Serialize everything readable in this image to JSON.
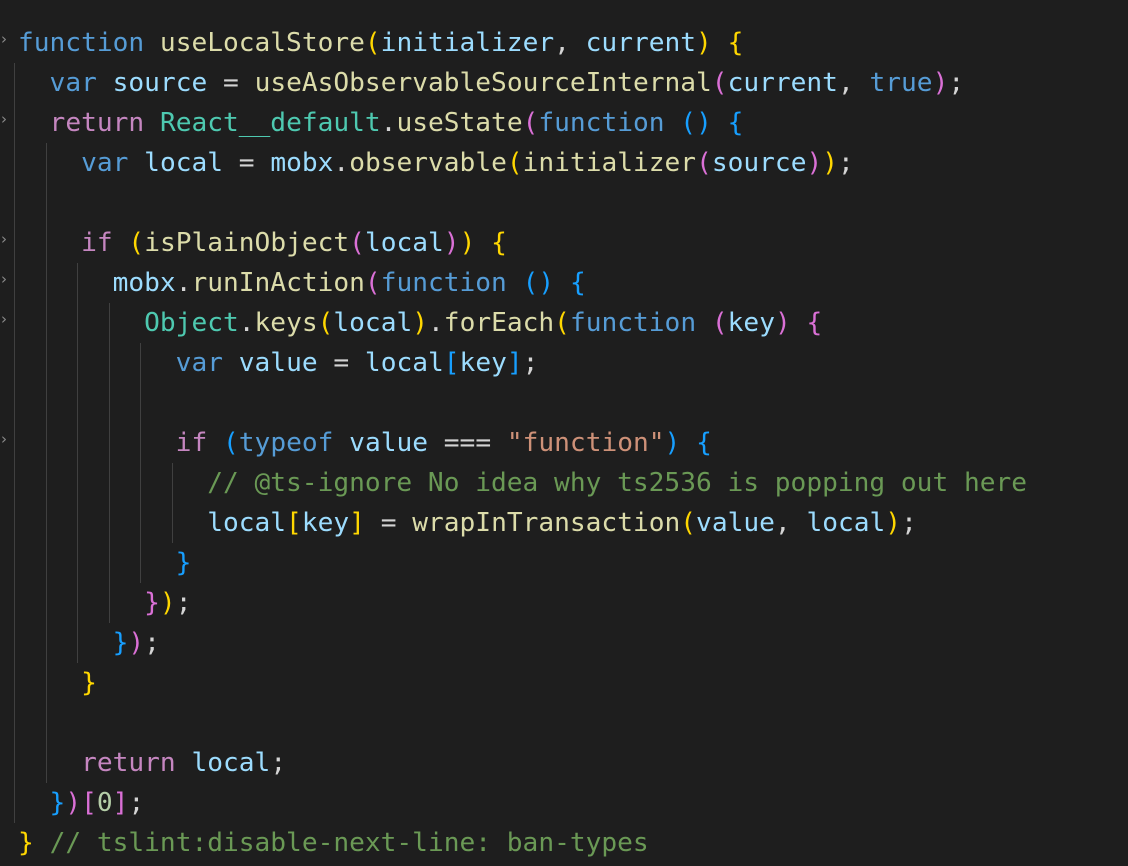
{
  "editor": {
    "theme": {
      "background": "#1e1e1e",
      "text": "#d4d4d4"
    },
    "fold_marker": "›",
    "lines": [
      [
        {
          "text": "function",
          "cls": "kw"
        },
        {
          "text": " ",
          "cls": "p"
        },
        {
          "text": "useLocalStore",
          "cls": "fn"
        },
        {
          "text": "(",
          "cls": "b1"
        },
        {
          "text": "initializer",
          "cls": "var"
        },
        {
          "text": ", ",
          "cls": "p"
        },
        {
          "text": "current",
          "cls": "var"
        },
        {
          "text": ")",
          "cls": "b1"
        },
        {
          "text": " ",
          "cls": "p"
        },
        {
          "text": "{",
          "cls": "b1"
        }
      ],
      [
        {
          "text": "  ",
          "cls": "p"
        },
        {
          "text": "var",
          "cls": "kw"
        },
        {
          "text": " ",
          "cls": "p"
        },
        {
          "text": "source",
          "cls": "var"
        },
        {
          "text": " = ",
          "cls": "p"
        },
        {
          "text": "useAsObservableSourceInternal",
          "cls": "fn"
        },
        {
          "text": "(",
          "cls": "b2"
        },
        {
          "text": "current",
          "cls": "var"
        },
        {
          "text": ", ",
          "cls": "p"
        },
        {
          "text": "true",
          "cls": "kw"
        },
        {
          "text": ")",
          "cls": "b2"
        },
        {
          "text": ";",
          "cls": "p"
        }
      ],
      [
        {
          "text": "  ",
          "cls": "p"
        },
        {
          "text": "return",
          "cls": "ctl"
        },
        {
          "text": " ",
          "cls": "p"
        },
        {
          "text": "React__default",
          "cls": "cls"
        },
        {
          "text": ".",
          "cls": "p"
        },
        {
          "text": "useState",
          "cls": "fn"
        },
        {
          "text": "(",
          "cls": "b2"
        },
        {
          "text": "function",
          "cls": "kw"
        },
        {
          "text": " ",
          "cls": "p"
        },
        {
          "text": "()",
          "cls": "b3"
        },
        {
          "text": " ",
          "cls": "p"
        },
        {
          "text": "{",
          "cls": "b3"
        }
      ],
      [
        {
          "text": "    ",
          "cls": "p"
        },
        {
          "text": "var",
          "cls": "kw"
        },
        {
          "text": " ",
          "cls": "p"
        },
        {
          "text": "local",
          "cls": "var"
        },
        {
          "text": " = ",
          "cls": "p"
        },
        {
          "text": "mobx",
          "cls": "var"
        },
        {
          "text": ".",
          "cls": "p"
        },
        {
          "text": "observable",
          "cls": "fn"
        },
        {
          "text": "(",
          "cls": "b1"
        },
        {
          "text": "initializer",
          "cls": "fn"
        },
        {
          "text": "(",
          "cls": "b2"
        },
        {
          "text": "source",
          "cls": "var"
        },
        {
          "text": ")",
          "cls": "b2"
        },
        {
          "text": ")",
          "cls": "b1"
        },
        {
          "text": ";",
          "cls": "p"
        }
      ],
      [],
      [
        {
          "text": "    ",
          "cls": "p"
        },
        {
          "text": "if",
          "cls": "ctl"
        },
        {
          "text": " ",
          "cls": "p"
        },
        {
          "text": "(",
          "cls": "b1"
        },
        {
          "text": "isPlainObject",
          "cls": "fn"
        },
        {
          "text": "(",
          "cls": "b2"
        },
        {
          "text": "local",
          "cls": "var"
        },
        {
          "text": ")",
          "cls": "b2"
        },
        {
          "text": ")",
          "cls": "b1"
        },
        {
          "text": " ",
          "cls": "p"
        },
        {
          "text": "{",
          "cls": "b1"
        }
      ],
      [
        {
          "text": "      ",
          "cls": "p"
        },
        {
          "text": "mobx",
          "cls": "var"
        },
        {
          "text": ".",
          "cls": "p"
        },
        {
          "text": "runInAction",
          "cls": "fn"
        },
        {
          "text": "(",
          "cls": "b2"
        },
        {
          "text": "function",
          "cls": "kw"
        },
        {
          "text": " ",
          "cls": "p"
        },
        {
          "text": "()",
          "cls": "b3"
        },
        {
          "text": " ",
          "cls": "p"
        },
        {
          "text": "{",
          "cls": "b3"
        }
      ],
      [
        {
          "text": "        ",
          "cls": "p"
        },
        {
          "text": "Object",
          "cls": "cls"
        },
        {
          "text": ".",
          "cls": "p"
        },
        {
          "text": "keys",
          "cls": "fn"
        },
        {
          "text": "(",
          "cls": "b1"
        },
        {
          "text": "local",
          "cls": "var"
        },
        {
          "text": ")",
          "cls": "b1"
        },
        {
          "text": ".",
          "cls": "p"
        },
        {
          "text": "forEach",
          "cls": "fn"
        },
        {
          "text": "(",
          "cls": "b1"
        },
        {
          "text": "function",
          "cls": "kw"
        },
        {
          "text": " ",
          "cls": "p"
        },
        {
          "text": "(",
          "cls": "b2"
        },
        {
          "text": "key",
          "cls": "var"
        },
        {
          "text": ")",
          "cls": "b2"
        },
        {
          "text": " ",
          "cls": "p"
        },
        {
          "text": "{",
          "cls": "b2"
        }
      ],
      [
        {
          "text": "          ",
          "cls": "p"
        },
        {
          "text": "var",
          "cls": "kw"
        },
        {
          "text": " ",
          "cls": "p"
        },
        {
          "text": "value",
          "cls": "var"
        },
        {
          "text": " = ",
          "cls": "p"
        },
        {
          "text": "local",
          "cls": "var"
        },
        {
          "text": "[",
          "cls": "b3"
        },
        {
          "text": "key",
          "cls": "var"
        },
        {
          "text": "]",
          "cls": "b3"
        },
        {
          "text": ";",
          "cls": "p"
        }
      ],
      [],
      [
        {
          "text": "          ",
          "cls": "p"
        },
        {
          "text": "if",
          "cls": "ctl"
        },
        {
          "text": " ",
          "cls": "p"
        },
        {
          "text": "(",
          "cls": "b3"
        },
        {
          "text": "typeof",
          "cls": "kw"
        },
        {
          "text": " ",
          "cls": "p"
        },
        {
          "text": "value",
          "cls": "var"
        },
        {
          "text": " === ",
          "cls": "p"
        },
        {
          "text": "\"function\"",
          "cls": "str"
        },
        {
          "text": ")",
          "cls": "b3"
        },
        {
          "text": " ",
          "cls": "p"
        },
        {
          "text": "{",
          "cls": "b3"
        }
      ],
      [
        {
          "text": "            ",
          "cls": "p"
        },
        {
          "text": "// @ts-ignore No idea why ts2536 is popping out here",
          "cls": "cmt"
        }
      ],
      [
        {
          "text": "            ",
          "cls": "p"
        },
        {
          "text": "local",
          "cls": "var"
        },
        {
          "text": "[",
          "cls": "b1"
        },
        {
          "text": "key",
          "cls": "var"
        },
        {
          "text": "]",
          "cls": "b1"
        },
        {
          "text": " = ",
          "cls": "p"
        },
        {
          "text": "wrapInTransaction",
          "cls": "fn"
        },
        {
          "text": "(",
          "cls": "b1"
        },
        {
          "text": "value",
          "cls": "var"
        },
        {
          "text": ", ",
          "cls": "p"
        },
        {
          "text": "local",
          "cls": "var"
        },
        {
          "text": ")",
          "cls": "b1"
        },
        {
          "text": ";",
          "cls": "p"
        }
      ],
      [
        {
          "text": "          ",
          "cls": "p"
        },
        {
          "text": "}",
          "cls": "b3"
        }
      ],
      [
        {
          "text": "        ",
          "cls": "p"
        },
        {
          "text": "}",
          "cls": "b2"
        },
        {
          "text": ")",
          "cls": "b1"
        },
        {
          "text": ";",
          "cls": "p"
        }
      ],
      [
        {
          "text": "      ",
          "cls": "p"
        },
        {
          "text": "}",
          "cls": "b3"
        },
        {
          "text": ")",
          "cls": "b2"
        },
        {
          "text": ";",
          "cls": "p"
        }
      ],
      [
        {
          "text": "    ",
          "cls": "p"
        },
        {
          "text": "}",
          "cls": "b1"
        }
      ],
      [],
      [
        {
          "text": "    ",
          "cls": "p"
        },
        {
          "text": "return",
          "cls": "ctl"
        },
        {
          "text": " ",
          "cls": "p"
        },
        {
          "text": "local",
          "cls": "var"
        },
        {
          "text": ";",
          "cls": "p"
        }
      ],
      [
        {
          "text": "  ",
          "cls": "p"
        },
        {
          "text": "}",
          "cls": "b3"
        },
        {
          "text": ")",
          "cls": "b2"
        },
        {
          "text": "[",
          "cls": "b2"
        },
        {
          "text": "0",
          "cls": "num"
        },
        {
          "text": "]",
          "cls": "b2"
        },
        {
          "text": ";",
          "cls": "p"
        }
      ],
      [
        {
          "text": "}",
          "cls": "b1"
        },
        {
          "text": " ",
          "cls": "p"
        },
        {
          "text": "// tslint:disable-next-line: ban-types",
          "cls": "cmt"
        }
      ]
    ]
  }
}
